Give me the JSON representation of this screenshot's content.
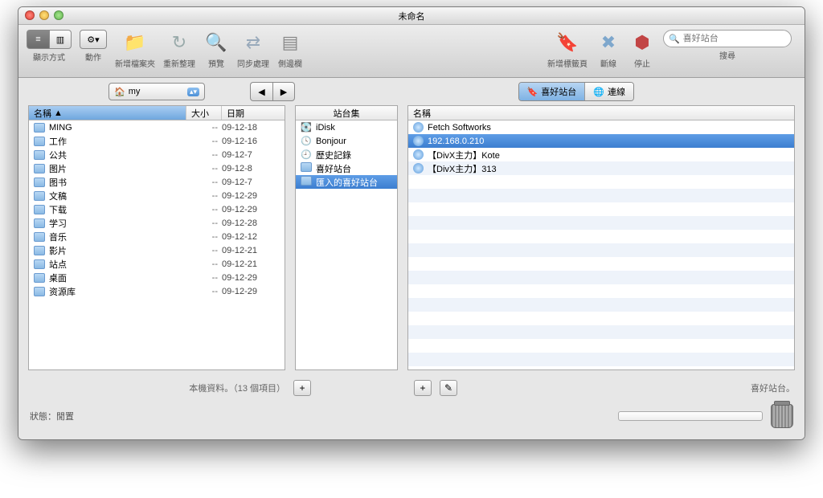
{
  "window": {
    "title": "未命名"
  },
  "toolbar": {
    "view_label": "顯示方式",
    "action_label": "動作",
    "newfolder_label": "新增檔案夾",
    "reload_label": "重新整理",
    "preview_label": "預覽",
    "sync_label": "同步處理",
    "sidebar_label": "側邊欄",
    "newbookmark_label": "新增標籤頁",
    "disconnect_label": "斷線",
    "stop_label": "停止",
    "search_label": "搜尋",
    "search_placeholder": "喜好站台"
  },
  "path": {
    "current": "my"
  },
  "tabs": {
    "fav": "喜好站台",
    "conn": "連線"
  },
  "left": {
    "col_name": "名稱",
    "col_size": "大小",
    "col_date": "日期",
    "items": [
      {
        "name": "MING",
        "size": "--",
        "date": "09-12-18"
      },
      {
        "name": "工作",
        "size": "--",
        "date": "09-12-16"
      },
      {
        "name": "公共",
        "size": "--",
        "date": "09-12-7"
      },
      {
        "name": "图片",
        "size": "--",
        "date": "09-12-8"
      },
      {
        "name": "图书",
        "size": "--",
        "date": "09-12-7"
      },
      {
        "name": "文稿",
        "size": "--",
        "date": "09-12-29"
      },
      {
        "name": "下载",
        "size": "--",
        "date": "09-12-29"
      },
      {
        "name": "学习",
        "size": "--",
        "date": "09-12-28"
      },
      {
        "name": "音乐",
        "size": "--",
        "date": "09-12-12"
      },
      {
        "name": "影片",
        "size": "--",
        "date": "09-12-21"
      },
      {
        "name": "站点",
        "size": "--",
        "date": "09-12-21"
      },
      {
        "name": "桌面",
        "size": "--",
        "date": "09-12-29"
      },
      {
        "name": "资源库",
        "size": "--",
        "date": "09-12-29"
      }
    ],
    "footer": "本機資料。（13 個項目）"
  },
  "mid": {
    "header": "站台集",
    "items": [
      "iDisk",
      "Bonjour",
      "歷史記錄",
      "喜好站台",
      "匯入的喜好站台"
    ],
    "selected_index": 4
  },
  "right": {
    "col_name": "名稱",
    "items": [
      "Fetch Softworks",
      "192.168.0.210",
      "【DivX主力】Kote",
      "【DivX主力】313"
    ],
    "selected_index": 1,
    "footer": "喜好站台。"
  },
  "status": {
    "label": "狀態：閒置"
  }
}
